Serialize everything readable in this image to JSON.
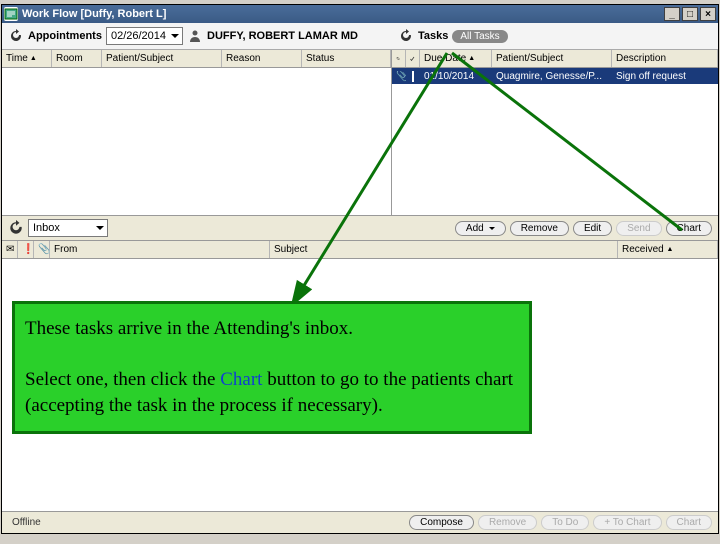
{
  "title": "Work Flow [Duffy, Robert L]",
  "appointments": {
    "heading": "Appointments",
    "date": "02/26/2014",
    "provider": "DUFFY, ROBERT LAMAR MD",
    "columns": {
      "time": "Time",
      "room": "Room",
      "patient": "Patient/Subject",
      "reason": "Reason",
      "status": "Status"
    }
  },
  "tasks": {
    "heading": "Tasks",
    "filter": "All Tasks",
    "columns": {
      "duedate": "Due Date",
      "patient": "Patient/Subject",
      "description": "Description"
    },
    "rows": [
      {
        "due": "01/10/2014",
        "patient": "Quagmire, Genesse/P...",
        "description": "Sign off request"
      }
    ]
  },
  "mid": {
    "inbox": "Inbox",
    "buttons": {
      "add": "Add",
      "remove": "Remove",
      "edit": "Edit",
      "send": "Send",
      "chart": "Chart"
    }
  },
  "inbox_cols": {
    "from": "From",
    "subject": "Subject",
    "received": "Received"
  },
  "bottom": {
    "status": "Offline",
    "buttons": {
      "compose": "Compose",
      "remove": "Remove",
      "todo": "To Do",
      "tochart": "+ To Chart",
      "chart": "Chart"
    }
  },
  "annotation": {
    "line1": "These tasks arrive in the Attending's inbox.",
    "line2a": "Select one, then click the ",
    "line2b": "Chart",
    "line2c": " button to go to the patients chart (accepting the task in the process if necessary)."
  }
}
